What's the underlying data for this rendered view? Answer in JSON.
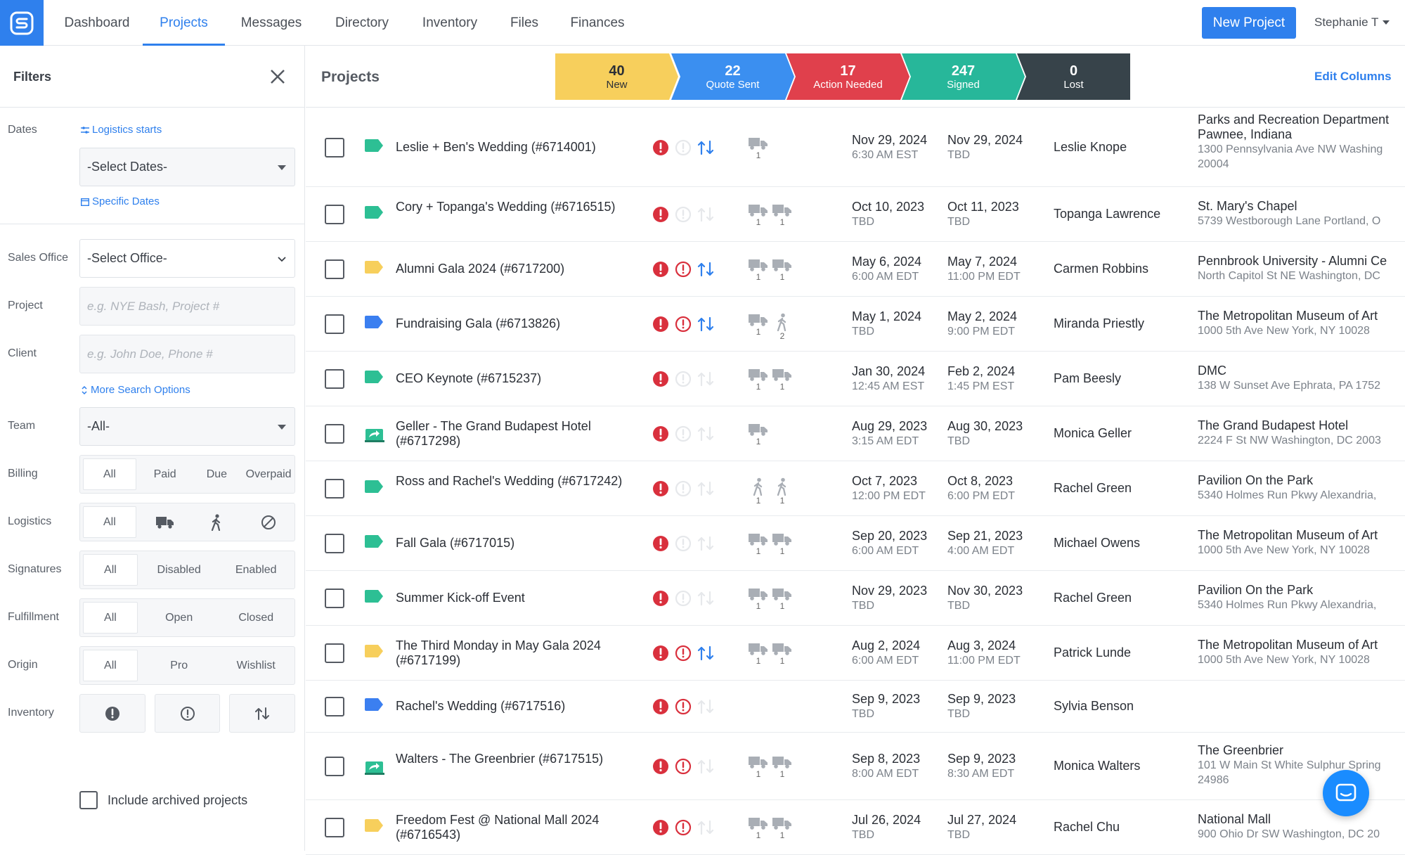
{
  "nav": {
    "tabs": [
      {
        "label": "Dashboard"
      },
      {
        "label": "Projects"
      },
      {
        "label": "Messages"
      },
      {
        "label": "Directory"
      },
      {
        "label": "Inventory"
      },
      {
        "label": "Files"
      },
      {
        "label": "Finances"
      }
    ],
    "active_tab": "Projects",
    "new_project_label": "New Project",
    "user_name": "Stephanie T"
  },
  "filters": {
    "title": "Filters",
    "dates_label": "Dates",
    "logistics_starts_link": "Logistics starts",
    "dates_select_value": "-Select Dates-",
    "specific_dates_link": "Specific Dates",
    "sales_office_label": "Sales Office",
    "sales_office_value": "-Select Office-",
    "project_label": "Project",
    "project_placeholder": "e.g. NYE Bash, Project #",
    "client_label": "Client",
    "client_placeholder": "e.g. John Doe, Phone #",
    "more_search_link": "More Search Options",
    "team_label": "Team",
    "team_value": "-All-",
    "billing_label": "Billing",
    "billing_options": [
      "All",
      "Paid",
      "Due",
      "Overpaid"
    ],
    "logistics_label": "Logistics",
    "logistics_all": "All",
    "signatures_label": "Signatures",
    "signatures_options": [
      "All",
      "Disabled",
      "Enabled"
    ],
    "fulfillment_label": "Fulfillment",
    "fulfillment_options": [
      "All",
      "Open",
      "Closed"
    ],
    "origin_label": "Origin",
    "origin_options": [
      "All",
      "Pro",
      "Wishlist"
    ],
    "inventory_label": "Inventory",
    "archived_label": "Include archived projects"
  },
  "main": {
    "title": "Projects",
    "edit_columns": "Edit Columns",
    "pipeline": [
      {
        "count": "40",
        "label": "New",
        "color": "#f7cf5c",
        "text": "#2b2f36"
      },
      {
        "count": "22",
        "label": "Quote Sent",
        "color": "#3b8ff0",
        "text": "#ffffff"
      },
      {
        "count": "17",
        "label": "Action Needed",
        "color": "#e0404c",
        "text": "#ffffff"
      },
      {
        "count": "247",
        "label": "Signed",
        "color": "#27b79a",
        "text": "#ffffff"
      },
      {
        "count": "0",
        "label": "Lost",
        "color": "#37434a",
        "text": "#ffffff"
      }
    ]
  },
  "colors": {
    "accent": "#2f80ed",
    "tag_green": "#2dbf94",
    "tag_yellow": "#f7cf5c",
    "tag_blue": "#3b7ff0",
    "alert_red": "#d9303d"
  },
  "rows": [
    {
      "name": "Leslie + Ben's Wedding (#6714001)",
      "tag": "green",
      "alerts": "a1-f0-s1",
      "logistics": "t",
      "counts": [
        "1"
      ],
      "start": "Nov 29, 2024",
      "start_time": "6:30 AM EST",
      "end": "Nov 29, 2024",
      "end_time": "TBD",
      "client": "Leslie Knope",
      "venue": "Parks and Recreation Department",
      "venue2": "Pawnee, Indiana",
      "address": "1300 Pennsylvania Ave NW Washing 20004"
    },
    {
      "name": "Cory + Topanga's Wedding (#6716515)",
      "tag": "green",
      "alerts": "a1-f0-s0",
      "logistics": "tt",
      "counts": [
        "1",
        "1"
      ],
      "start": "Oct 10, 2023",
      "start_time": "TBD",
      "end": "Oct 11, 2023",
      "end_time": "TBD",
      "client": "Topanga Lawrence",
      "venue": "St. Mary's Chapel",
      "venue2": "",
      "address": "5739 Westborough Lane Portland, O"
    },
    {
      "name": "Alumni Gala 2024 (#6717200)",
      "tag": "yellow",
      "alerts": "a1-f1-s1",
      "logistics": "tt",
      "counts": [
        "1",
        "1"
      ],
      "start": "May 6, 2024",
      "start_time": "6:00 AM EDT",
      "end": "May 7, 2024",
      "end_time": "11:00 PM EDT",
      "client": "Carmen Robbins",
      "venue": "Pennbrook University - Alumni Ce",
      "venue2": "",
      "address": "North Capitol St NE Washington, DC"
    },
    {
      "name": "Fundraising Gala (#6713826)",
      "tag": "blue",
      "alerts": "a1-f1-s1",
      "logistics": "tw",
      "counts": [
        "1",
        "2"
      ],
      "start": "May 1, 2024",
      "start_time": "TBD",
      "end": "May 2, 2024",
      "end_time": "9:00 PM EDT",
      "client": "Miranda Priestly",
      "venue": "The Metropolitan Museum of Art",
      "venue2": "",
      "address": "1000 5th Ave New York, NY 10028"
    },
    {
      "name": "CEO Keynote (#6715237)",
      "tag": "green",
      "alerts": "a1-f0-s0",
      "logistics": "tt",
      "counts": [
        "1",
        "1"
      ],
      "start": "Jan 30, 2024",
      "start_time": "12:45 AM EST",
      "end": "Feb 2, 2024",
      "end_time": "1:45 PM EST",
      "client": "Pam Beesly",
      "venue": "DMC",
      "venue2": "",
      "address": "138 W Sunset Ave Ephrata, PA 1752"
    },
    {
      "name": "Geller - The Grand Budapest Hotel (#6717298)",
      "tag": "share",
      "alerts": "a1-f0-s0",
      "logistics": "t",
      "counts": [
        "1"
      ],
      "start": "Aug 29, 2023",
      "start_time": "3:15 AM EDT",
      "end": "Aug 30, 2023",
      "end_time": "TBD",
      "client": "Monica Geller",
      "venue": "The Grand Budapest Hotel",
      "venue2": "",
      "address": "2224 F St NW Washington, DC 2003"
    },
    {
      "name": "Ross and Rachel's Wedding (#6717242)",
      "tag": "green",
      "alerts": "a1-f0-s0",
      "logistics": "ww",
      "counts": [
        "1",
        "1"
      ],
      "start": "Oct 7, 2023",
      "start_time": "12:00 PM EDT",
      "end": "Oct 8, 2023",
      "end_time": "6:00 PM EDT",
      "client": "Rachel Green",
      "venue": "Pavilion On the Park",
      "venue2": "",
      "address": "5340 Holmes Run Pkwy Alexandria,"
    },
    {
      "name": "Fall Gala (#6717015)",
      "tag": "green",
      "alerts": "a1-f0-s0",
      "logistics": "tt",
      "counts": [
        "1",
        "1"
      ],
      "start": "Sep 20, 2023",
      "start_time": "6:00 AM EDT",
      "end": "Sep 21, 2023",
      "end_time": "4:00 AM EDT",
      "client": "Michael Owens",
      "venue": "The Metropolitan Museum of Art",
      "venue2": "",
      "address": "1000 5th Ave New York, NY 10028"
    },
    {
      "name": "Summer Kick-off Event",
      "tag": "green",
      "alerts": "a1-f0-s0",
      "logistics": "tt",
      "counts": [
        "1",
        "1"
      ],
      "start": "Nov 29, 2023",
      "start_time": "TBD",
      "end": "Nov 30, 2023",
      "end_time": "TBD",
      "client": "Rachel Green",
      "venue": "Pavilion On the Park",
      "venue2": "",
      "address": "5340 Holmes Run Pkwy Alexandria,"
    },
    {
      "name": "The Third Monday in May Gala 2024 (#6717199)",
      "tag": "yellow",
      "alerts": "a1-f1-s1",
      "logistics": "tt",
      "counts": [
        "1",
        "1"
      ],
      "start": "Aug 2, 2024",
      "start_time": "6:00 AM EDT",
      "end": "Aug 3, 2024",
      "end_time": "11:00 PM EDT",
      "client": "Patrick Lunde",
      "venue": "The Metropolitan Museum of Art",
      "venue2": "",
      "address": "1000 5th Ave New York, NY 10028"
    },
    {
      "name": "Rachel's Wedding (#6717516)",
      "tag": "blue",
      "alerts": "a1-f1-s0",
      "logistics": "",
      "counts": [],
      "start": "Sep 9, 2023",
      "start_time": "TBD",
      "end": "Sep 9, 2023",
      "end_time": "TBD",
      "client": "Sylvia Benson",
      "venue": "",
      "venue2": "",
      "address": ""
    },
    {
      "name": "Walters - The Greenbrier (#6717515)",
      "tag": "share",
      "alerts": "a1-f1-s0",
      "logistics": "tt",
      "counts": [
        "1",
        "1"
      ],
      "start": "Sep 8, 2023",
      "start_time": "8:00 AM EDT",
      "end": "Sep 9, 2023",
      "end_time": "8:30 AM EDT",
      "client": "Monica Walters",
      "venue": "The Greenbrier",
      "venue2": "",
      "address": "101 W Main St White Sulphur Spring 24986"
    },
    {
      "name": "Freedom Fest @ National Mall 2024 (#6716543)",
      "tag": "yellow",
      "alerts": "a1-f1-s0",
      "logistics": "tt",
      "counts": [
        "1",
        "1"
      ],
      "start": "Jul 26, 2024",
      "start_time": "TBD",
      "end": "Jul 27, 2024",
      "end_time": "TBD",
      "client": "Rachel Chu",
      "venue": "National Mall",
      "venue2": "",
      "address": "900 Ohio Dr SW Washington, DC 20"
    }
  ]
}
